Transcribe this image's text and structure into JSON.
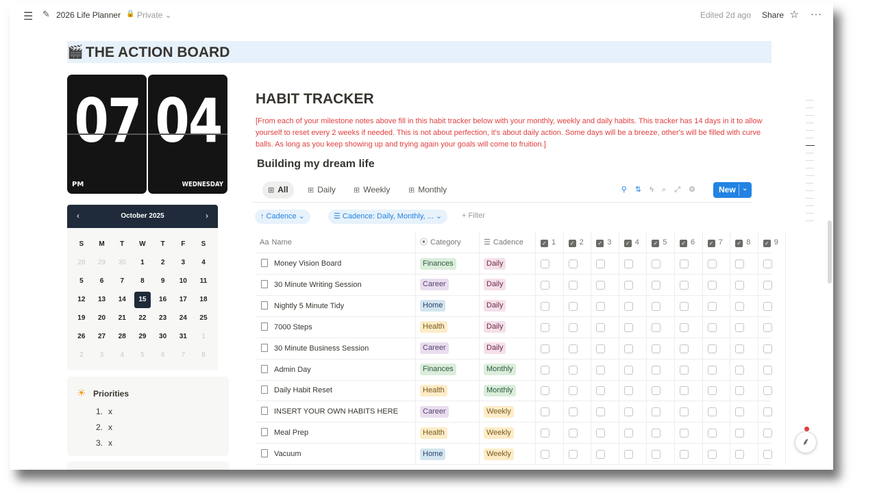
{
  "topbar": {
    "page_title": "2026 Life Planner",
    "privacy": "Private ⌄",
    "edited": "Edited 2d ago",
    "share": "Share"
  },
  "banner": {
    "title": "THE ACTION BOARD",
    "emoji": "🎬"
  },
  "clock": {
    "hour": "07",
    "minute": "04",
    "ampm": "PM",
    "weekday": "WEDNESDAY"
  },
  "calendar": {
    "month": "October 2025",
    "weekdays": [
      "S",
      "M",
      "T",
      "W",
      "T",
      "F",
      "S"
    ],
    "days": [
      {
        "d": "28",
        "dim": true
      },
      {
        "d": "29",
        "dim": true
      },
      {
        "d": "30",
        "dim": true
      },
      {
        "d": "1"
      },
      {
        "d": "2"
      },
      {
        "d": "3"
      },
      {
        "d": "4"
      },
      {
        "d": "5"
      },
      {
        "d": "6"
      },
      {
        "d": "7"
      },
      {
        "d": "8"
      },
      {
        "d": "9"
      },
      {
        "d": "10"
      },
      {
        "d": "11"
      },
      {
        "d": "12"
      },
      {
        "d": "13"
      },
      {
        "d": "14"
      },
      {
        "d": "15",
        "sel": true
      },
      {
        "d": "16"
      },
      {
        "d": "17"
      },
      {
        "d": "18"
      },
      {
        "d": "19"
      },
      {
        "d": "20"
      },
      {
        "d": "21"
      },
      {
        "d": "22"
      },
      {
        "d": "23"
      },
      {
        "d": "24"
      },
      {
        "d": "25"
      },
      {
        "d": "26"
      },
      {
        "d": "27"
      },
      {
        "d": "28"
      },
      {
        "d": "29"
      },
      {
        "d": "30"
      },
      {
        "d": "31"
      },
      {
        "d": "1",
        "dim": true
      },
      {
        "d": "2",
        "dim": true
      },
      {
        "d": "3",
        "dim": true
      },
      {
        "d": "4",
        "dim": true
      },
      {
        "d": "5",
        "dim": true
      },
      {
        "d": "6",
        "dim": true
      },
      {
        "d": "7",
        "dim": true
      },
      {
        "d": "8",
        "dim": true
      }
    ]
  },
  "priorities": {
    "title": "Priorities",
    "items": [
      {
        "n": "1.",
        "t": "x"
      },
      {
        "n": "2.",
        "t": "x"
      },
      {
        "n": "3.",
        "t": "x"
      }
    ]
  },
  "habit": {
    "title": "HABIT TRACKER",
    "description": "[From each of your milestone notes above fill in this habit tracker below with your monthly, weekly and daily habits. This tracker has 14 days in it to allow yourself to reset every 2 weeks if needed. This is not about perfection, it's about daily action. Some days will be a breeze, other's will be filled with curve balls. As long as you keep showing up and trying again your goals will come to fruition.]",
    "subtitle": "Building my dream life"
  },
  "views": {
    "tabs": [
      {
        "label": "All",
        "active": true
      },
      {
        "label": "Daily"
      },
      {
        "label": "Weekly"
      },
      {
        "label": "Monthly"
      }
    ],
    "new_label": "New"
  },
  "filters": {
    "sort_chip": "↑ Cadence ⌄",
    "filter_chip": "☰ Cadence: Daily, Monthly, ... ⌄",
    "add_filter": "+ Filter"
  },
  "table": {
    "headers": {
      "name": "Name",
      "category": "Category",
      "cadence": "Cadence"
    },
    "day_columns": [
      "1",
      "2",
      "3",
      "4",
      "5",
      "6",
      "7",
      "8",
      "9"
    ],
    "rows": [
      {
        "name": "Money Vision Board",
        "category": "Finances",
        "cadence": "Daily"
      },
      {
        "name": "30 Minute Writing Session",
        "category": "Career",
        "cadence": "Daily"
      },
      {
        "name": "Nightly 5 Minute Tidy",
        "category": "Home",
        "cadence": "Daily"
      },
      {
        "name": "7000 Steps",
        "category": "Health",
        "cadence": "Daily"
      },
      {
        "name": "30 Minute Business Session",
        "category": "Career",
        "cadence": "Daily"
      },
      {
        "name": "Admin Day",
        "category": "Finances",
        "cadence": "Monthly"
      },
      {
        "name": "Daily Habit Reset",
        "category": "Health",
        "cadence": "Monthly"
      },
      {
        "name": "INSERT YOUR OWN HABITS HERE",
        "category": "Career",
        "cadence": "Weekly"
      },
      {
        "name": "Meal Prep",
        "category": "Health",
        "cadence": "Weekly"
      },
      {
        "name": "Vacuum",
        "category": "Home",
        "cadence": "Weekly"
      }
    ]
  },
  "colors": {
    "Finances": {
      "bg": "#dbeddb",
      "fg": "#2b593f"
    },
    "Career": {
      "bg": "#e8deee",
      "fg": "#5a3e75"
    },
    "Home": {
      "bg": "#d3e5ef",
      "fg": "#28456c"
    },
    "Health": {
      "bg": "#fdecc8",
      "fg": "#7a5a1e"
    },
    "Daily": {
      "bg": "#f5e0e9",
      "fg": "#6c2b4a"
    },
    "Monthly": {
      "bg": "#dbeddb",
      "fg": "#2b593f"
    },
    "Weekly": {
      "bg": "#fdecc8",
      "fg": "#7a5a1e"
    }
  }
}
